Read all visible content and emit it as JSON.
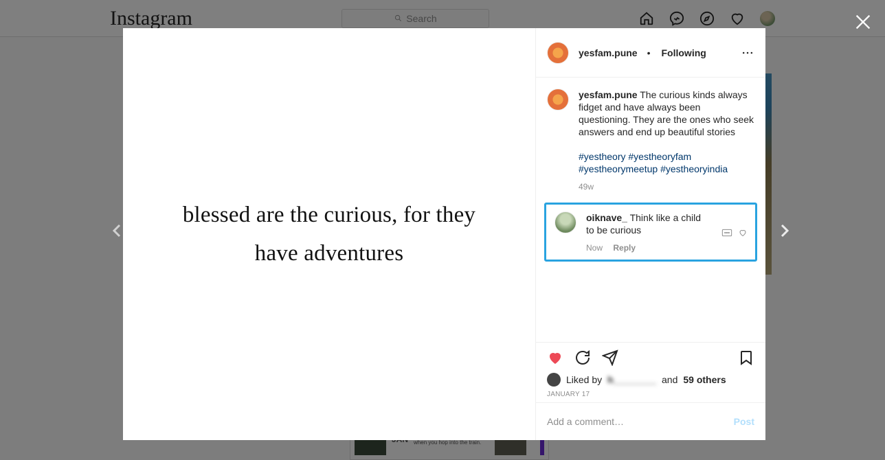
{
  "header": {
    "logo": "Instagram",
    "search_placeholder": "Search"
  },
  "post": {
    "author": "yesfam.pune",
    "follow_status": "Following",
    "image_quote": "blessed are the curious, for they have adventures",
    "caption": "The curious kinds always fidget and have always been questioning. They are the ones who seek answers and end up beautiful stories",
    "hashtags": "#yestheory #yestheoryfam #yestheorymeetup #yestheoryindia",
    "caption_age": "49w",
    "date": "JANUARY 17",
    "likes": {
      "prefix": "Liked by",
      "name": "h________",
      "middle": "and",
      "others": "59 others"
    },
    "comments": [
      {
        "user": "oiknave_",
        "text": "Think like a child to be curious",
        "age": "Now",
        "reply_label": "Reply"
      }
    ],
    "add_comment_placeholder": "Add a comment…",
    "post_button": "Post"
  },
  "bg_card": {
    "month": "JAN",
    "blurb": "Trek Location will be revealed when you hop into the train."
  }
}
